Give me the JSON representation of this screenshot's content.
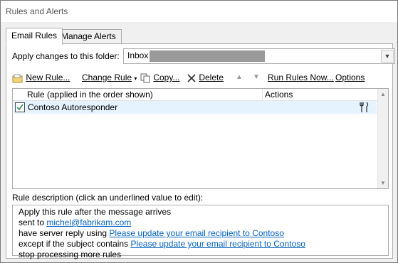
{
  "window": {
    "title": "Rules and Alerts"
  },
  "tabs": [
    {
      "label": "Email Rules",
      "active": true
    },
    {
      "label": "Manage Alerts",
      "active": false
    }
  ],
  "folder": {
    "label": "Apply changes to this folder:",
    "value": "Inbox"
  },
  "toolbar": {
    "new_rule": "New Rule...",
    "change_rule": "Change Rule",
    "copy": "Copy...",
    "delete": "Delete",
    "run_rules": "Run Rules Now...",
    "options": "Options"
  },
  "list": {
    "columns": [
      "Rule (applied in the order shown)",
      "Actions"
    ],
    "rows": [
      {
        "name": "Contoso Autoresponder",
        "checked": true
      }
    ]
  },
  "description": {
    "label": "Rule description (click an underlined value to edit):",
    "line1": "Apply this rule after the message arrives",
    "line2_prefix": "sent to",
    "line2_link": "michel@fabrikam.com",
    "line3_prefix": "have server reply using",
    "line3_link": "Please update your email recipient to Contoso",
    "line4_prefix": "except if the subject contains",
    "line4_link": "Please update your email recipient to Contoso",
    "line5": "stop processing more rules"
  },
  "colors": {
    "link": "#0563c1",
    "selected_row": "#e5f3ff",
    "check": "#2e8b57"
  }
}
